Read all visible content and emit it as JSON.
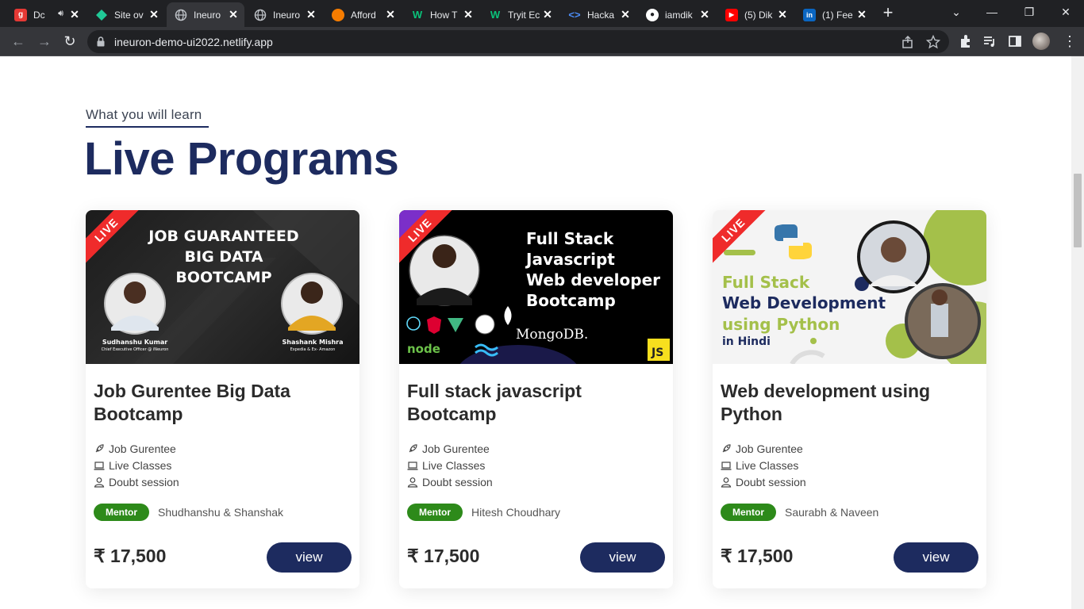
{
  "browser": {
    "tabs": [
      {
        "title": "Dc"
      },
      {
        "title": "Site ov"
      },
      {
        "title": "Ineuro"
      },
      {
        "title": "Ineuro"
      },
      {
        "title": "Afford"
      },
      {
        "title": "How T"
      },
      {
        "title": "Tryit Ec"
      },
      {
        "title": "Hacka"
      },
      {
        "title": "iamdik"
      },
      {
        "title": "(5) Dik"
      },
      {
        "title": "(1) Fee"
      }
    ],
    "url": "ineuron-demo-ui2022.netlify.app"
  },
  "section": {
    "eyebrow": "What you will learn",
    "heading": "Live Programs"
  },
  "cards": [
    {
      "ribbon": "LIVE",
      "banner_lines": [
        "JOB GUARANTEED",
        "BIG DATA",
        "BOOTCAMP"
      ],
      "banner_people": [
        {
          "name": "Sudhanshu Kumar",
          "role": "Chief Executive Officer @ iNeuron"
        },
        {
          "name": "Shashank Mishra",
          "role": "Expedia & Ex- Amazon"
        }
      ],
      "title": "Job Gurentee Big Data Bootcamp",
      "features": [
        "Job Gurentee",
        "Live Classes",
        "Doubt session"
      ],
      "mentor_label": "Mentor",
      "mentor": "Shudhanshu & Shanshak",
      "price": "₹ 17,500",
      "button": "view"
    },
    {
      "ribbon": "LIVE",
      "banner_lines": [
        "Full Stack",
        "Javascript",
        "Web developer",
        "Bootcamp"
      ],
      "banner_logos": [
        "MongoDB.",
        "JS"
      ],
      "title": "Full stack javascript Bootcamp",
      "features": [
        "Job Gurentee",
        "Live Classes",
        "Doubt session"
      ],
      "mentor_label": "Mentor",
      "mentor": "Hitesh Choudhary",
      "price": "₹ 17,500",
      "button": "view"
    },
    {
      "ribbon": "LIVE",
      "banner_lines": [
        "Full Stack",
        "Web Development",
        "using Python",
        "in Hindi"
      ],
      "title": "Web development using Python",
      "features": [
        "Job Gurentee",
        "Live Classes",
        "Doubt session"
      ],
      "mentor_label": "Mentor",
      "mentor": "Saurabh & Naveen",
      "price": "₹ 17,500",
      "button": "view"
    }
  ],
  "colors": {
    "primary": "#1d2b5f",
    "mentor_badge": "#2d8a1a",
    "ribbon": "#ef2b2b"
  }
}
